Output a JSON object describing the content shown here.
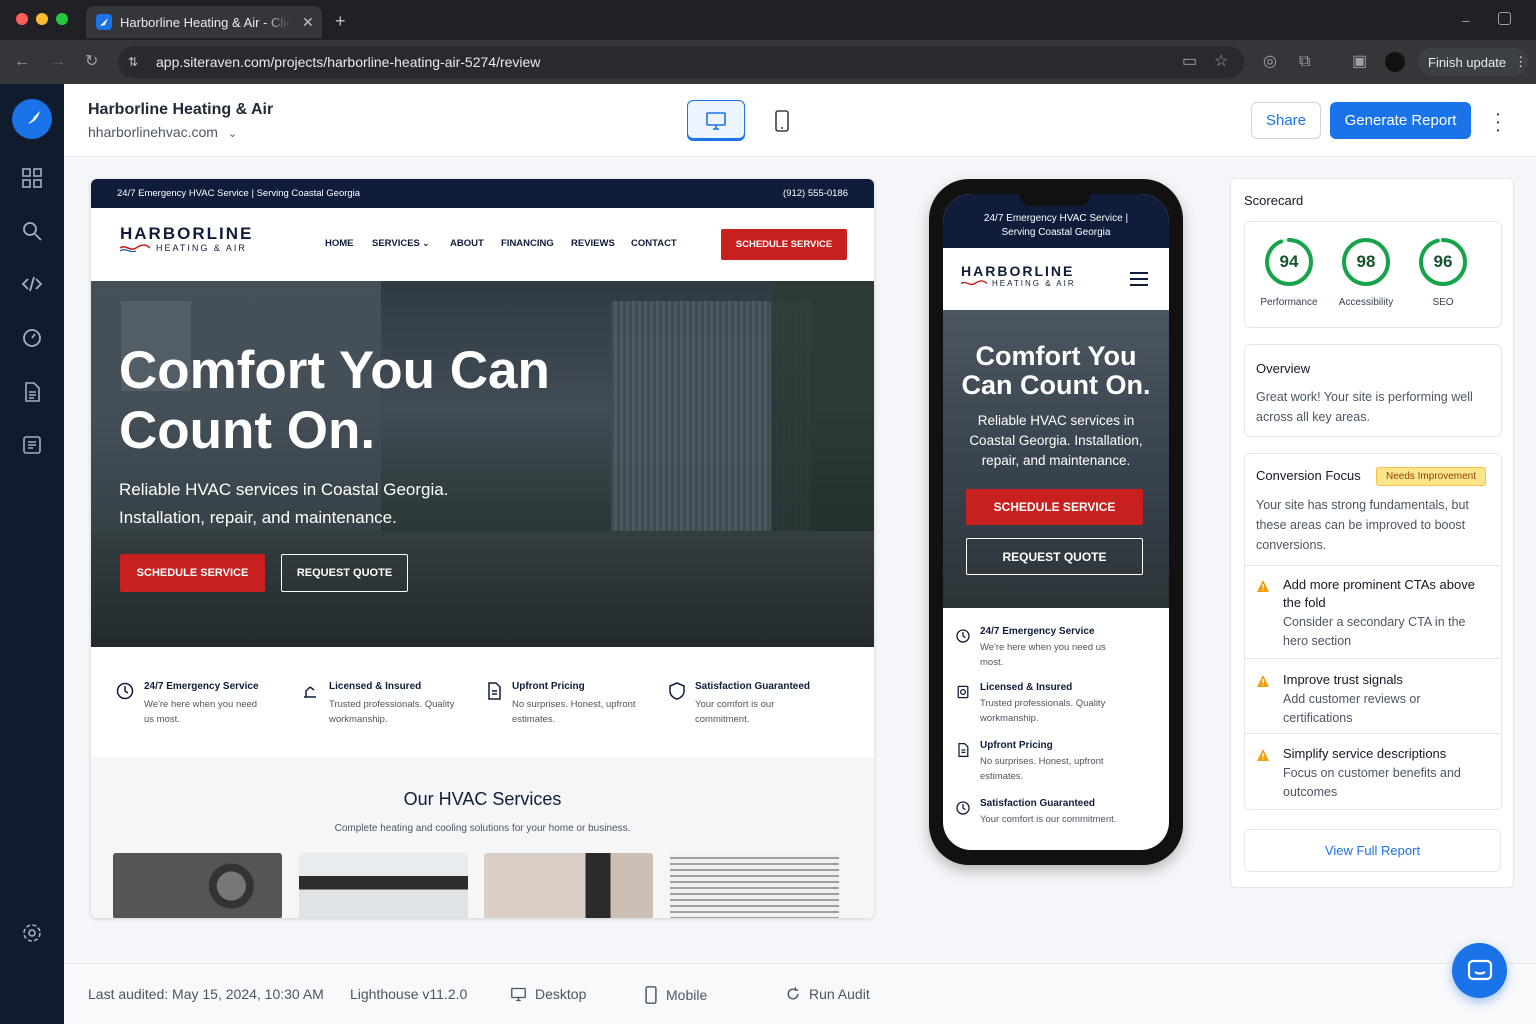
{
  "browser": {
    "tab_title": "Harborline Heating & Air - Client Review",
    "url": "app.siteraven.com/projects/harborline-heating-air-5274/review",
    "finish_update": "Finish update"
  },
  "header": {
    "project_name": "Harborline Heating & Air",
    "domain": "hharborlinehvac.com",
    "share_label": "Share",
    "generate_label": "Generate Report"
  },
  "desktop_preview": {
    "top_strip_left": "24/7 Emergency HVAC Service | Serving Coastal Georgia",
    "top_strip_right": "(912) 555-0186",
    "brand_main": "HARBORLINE",
    "brand_sub": "HEATING & AIR",
    "nav": [
      "HOME",
      "SERVICES",
      "ABOUT",
      "FINANCING",
      "REVIEWS",
      "CONTACT"
    ],
    "nav_cta": "SCHEDULE SERVICE",
    "hero_title": "Comfort You Can Count On.",
    "hero_text": "Reliable HVAC services in Coastal Georgia. Installation, repair, and maintenance.",
    "hero_primary": "SCHEDULE SERVICE",
    "hero_secondary": "REQUEST QUOTE",
    "features": [
      {
        "title": "24/7 Emergency Service",
        "desc": "We're here when you need us most."
      },
      {
        "title": "Licensed & Insured",
        "desc": "Trusted professionals. Quality workmanship."
      },
      {
        "title": "Upfront Pricing",
        "desc": "No surprises. Honest, upfront estimates."
      },
      {
        "title": "Satisfaction Guaranteed",
        "desc": "Your comfort is our commitment."
      }
    ],
    "services_title": "Our HVAC Services",
    "services_sub": "Complete heating and cooling solutions for your home or business."
  },
  "mobile_preview": {
    "top_strip": "24/7 Emergency HVAC Service | Serving Coastal Georgia",
    "brand_main": "HARBORLINE",
    "brand_sub": "HEATING & AIR",
    "hero_title": "Comfort You Can Count On.",
    "hero_text": "Reliable HVAC services in Coastal Georgia. Installation, repair, and maintenance.",
    "primary": "SCHEDULE SERVICE",
    "secondary": "REQUEST QUOTE",
    "features": [
      {
        "title": "24/7 Emergency Service",
        "desc": "We're here when you need us most."
      },
      {
        "title": "Licensed & Insured",
        "desc": "Trusted professionals. Quality workmanship."
      },
      {
        "title": "Upfront Pricing",
        "desc": "No surprises. Honest, upfront estimates."
      },
      {
        "title": "Satisfaction Guaranteed",
        "desc": "Your comfort is our commitment."
      }
    ]
  },
  "scorecard": {
    "title": "Scorecard",
    "scores": [
      {
        "label": "Performance",
        "value": 94
      },
      {
        "label": "Accessibility",
        "value": 98
      },
      {
        "label": "SEO",
        "value": 96
      }
    ]
  },
  "overview": {
    "title": "Overview",
    "text": "Great work! Your site is performing well across all key areas."
  },
  "conversion": {
    "title": "Conversion Focus",
    "badge": "Needs Improvement",
    "text": "Your site has strong fundamentals, but these areas can be improved to boost conversions.",
    "items": [
      {
        "title": "Add more prominent CTAs above the fold",
        "desc": "Consider a secondary CTA in the hero section"
      },
      {
        "title": "Improve trust signals",
        "desc": "Add customer reviews or certifications"
      },
      {
        "title": "Simplify service descriptions",
        "desc": "Focus on customer benefits and outcomes"
      }
    ]
  },
  "view_full_report": "View Full Report",
  "footer": {
    "last_audited": "Last audited: May 15, 2024, 10:30 AM",
    "lighthouse": "Lighthouse v11.2.0",
    "desktop": "Desktop",
    "mobile": "Mobile",
    "run_audit": "Run Audit"
  },
  "colors": {
    "accent": "#1a73e8",
    "navy": "#0f1d3a",
    "cta_red": "#c8201f",
    "score_green": "#16a34a",
    "warning": "#f59e0b"
  }
}
